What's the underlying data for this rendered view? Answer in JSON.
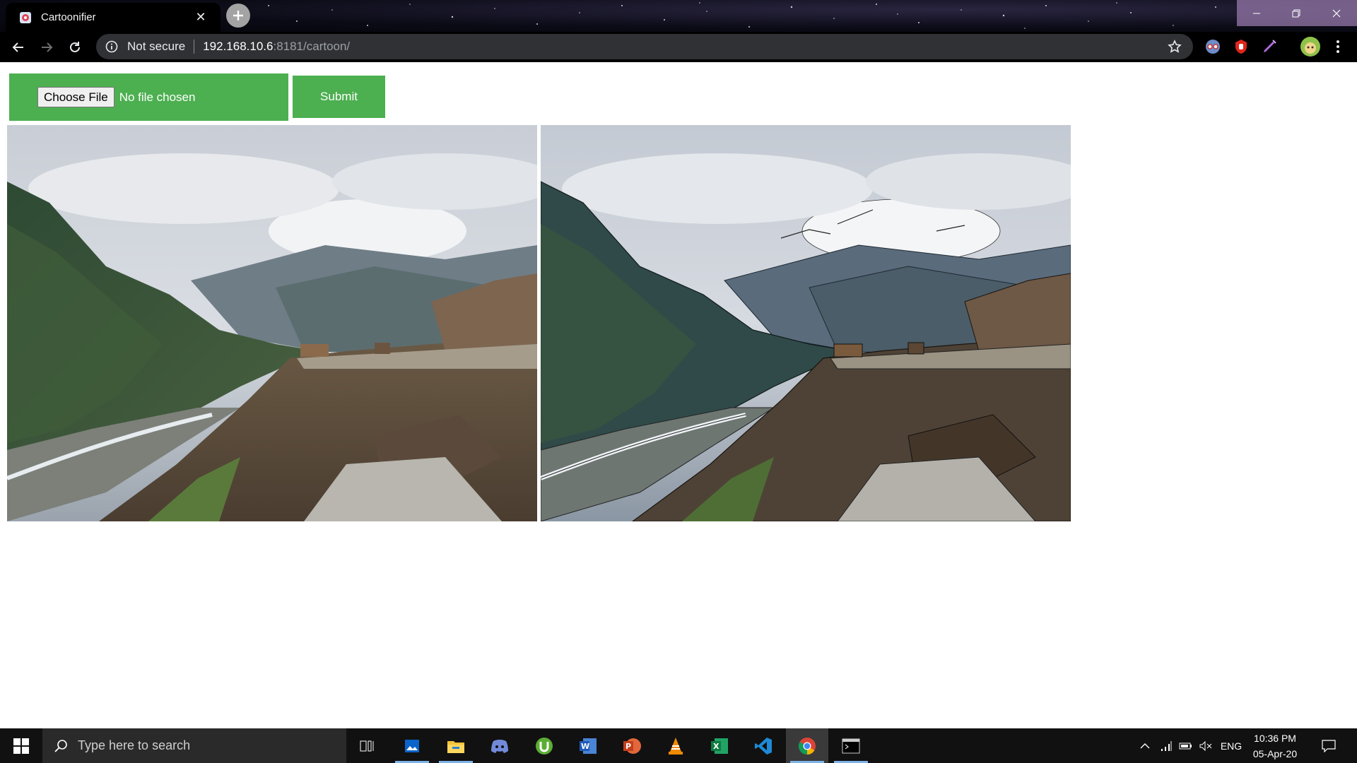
{
  "browser": {
    "tab_title": "Cartoonifier",
    "tab_close_glyph": "✕",
    "security_label": "Not secure",
    "url_host": "192.168.10.6",
    "url_path": ":8181/cartoon/"
  },
  "form": {
    "choose_file_label": "Choose File",
    "file_status": "No file chosen",
    "submit_label": "Submit",
    "accent_color": "#4caf50"
  },
  "images": {
    "original": {
      "name": "original-mountain-photo",
      "style": "photo"
    },
    "cartoon": {
      "name": "cartoonified-mountain-photo",
      "style": "cartoon"
    }
  },
  "taskbar": {
    "search_placeholder": "Type here to search",
    "apps": [
      "task-view-icon",
      "photos-icon",
      "file-explorer-icon",
      "discord-icon",
      "utorrent-icon",
      "word-icon",
      "powerpoint-icon",
      "vlc-icon",
      "excel-icon",
      "vscode-icon",
      "chrome-icon",
      "terminal-icon"
    ],
    "language": "ENG",
    "time": "10:36 PM",
    "date": "05-Apr-20"
  }
}
